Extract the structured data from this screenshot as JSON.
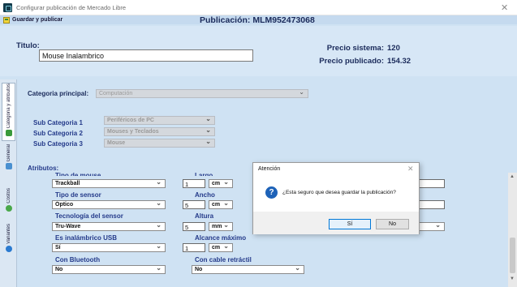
{
  "window": {
    "title": "Configurar publicación de Mercado Libre"
  },
  "toolbar": {
    "save_label": "Guardar y publicar",
    "publication_title": "Publicación: MLM952473068"
  },
  "header": {
    "titulo_label": "Titulo:",
    "titulo_value": "Mouse Inalambrico",
    "precio_sistema_label": "Precio sistema:",
    "precio_sistema_value": "120",
    "precio_publicado_label": "Precio publicado:",
    "precio_publicado_value": "154.32"
  },
  "tabs": [
    {
      "label": "Categoria y atributos",
      "active": true
    },
    {
      "label": "General"
    },
    {
      "label": "Costos"
    },
    {
      "label": "Variantes"
    }
  ],
  "categoria": {
    "principal_label": "Categoria principal:",
    "principal_value": "Computación",
    "sub1_label": "Sub Categoria 1",
    "sub1_value": "Periféricos de PC",
    "sub2_label": "Sub Categoria 2",
    "sub2_value": "Mouses y Teclados",
    "sub3_label": "Sub Categoria 3",
    "sub3_value": "Mouse"
  },
  "atributos": {
    "section_label": "Atributos:",
    "tipo_mouse_label": "Tipo de mouse",
    "tipo_mouse_value": "Trackball",
    "tipo_sensor_label": "Tipo de sensor",
    "tipo_sensor_value": "Óptico",
    "tecnologia_label": "Tecnología del sensor",
    "tecnologia_value": "Tru-Wave",
    "inalambrico_label": "Es inalámbrico USB",
    "inalambrico_value": "Sí",
    "bluetooth_label": "Con Bluetooth",
    "bluetooth_value": "No",
    "largo_label": "Largo",
    "largo_value": "1",
    "largo_unit": "cm",
    "ancho_label": "Ancho",
    "ancho_value": "5",
    "ancho_unit": "cm",
    "altura_label": "Altura",
    "altura_value": "5",
    "altura_unit": "mm",
    "alcance_label": "Alcance máximo",
    "alcance_value": "1",
    "alcance_unit": "cm",
    "cable_label": "Con cable retráctil",
    "cable_value": "No",
    "right_select_value": "No"
  },
  "dialog": {
    "title": "Atención",
    "message": "¿Esta seguro que desea guardar la publicación?",
    "yes_label": "Sí",
    "no_label": "No"
  },
  "colors": {
    "panel_bg": "#cfe2f3",
    "label_blue": "#243a8a",
    "dialog_primary": "#0078d7"
  }
}
